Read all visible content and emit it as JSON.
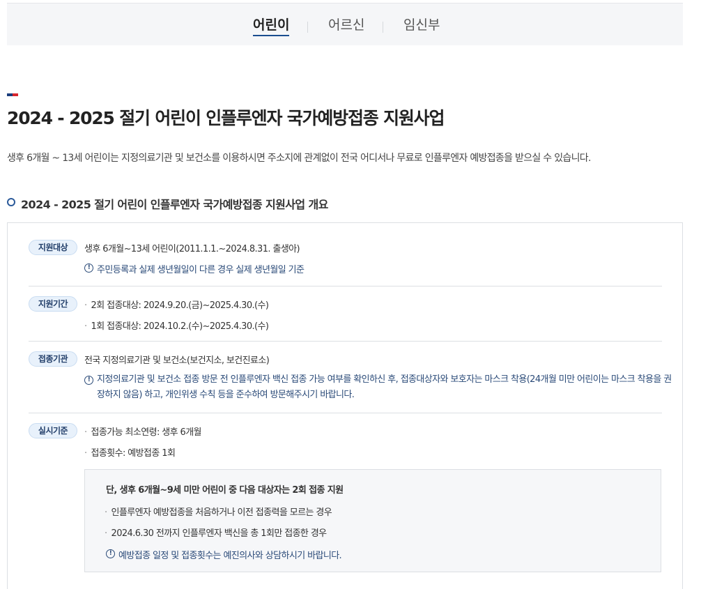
{
  "tabs": [
    {
      "label": "어린이",
      "active": true
    },
    {
      "label": "어르신",
      "active": false
    },
    {
      "label": "임신부",
      "active": false
    }
  ],
  "accent_colors": {
    "navy": "#1a3d7c",
    "red": "#d8262e",
    "link": "#2a4a78"
  },
  "page_title": "2024 - 2025 절기 어린이 인플루엔자 국가예방접종 지원사업",
  "intro": "생후 6개월 ~ 13세 어린이는 지정의료기관 및 보건소를 이용하시면 주소지에 관계없이 전국 어디서나 무료로 인플루엔자 예방접종을 받으실 수 있습니다.",
  "section_title": "2024 - 2025 절기 어린이 인플루엔자 국가예방접종 지원사업 개요",
  "rows": {
    "target": {
      "badge": "지원대상",
      "text": "생후 6개월~13세 어린이(2011.1.1.~2024.8.31. 출생아)",
      "note": "주민등록과 실제 생년월일이 다른 경우 실제 생년월일 기준"
    },
    "period": {
      "badge": "지원기간",
      "items": [
        "2회 접종대상: 2024.9.20.(금)~2025.4.30.(수)",
        "1회 접종대상: 2024.10.2.(수)~2025.4.30.(수)"
      ]
    },
    "institution": {
      "badge": "접종기관",
      "text": "전국 지정의료기관 및 보건소(보건지소, 보건진료소)",
      "note": "지정의료기관 및 보건소 접종 방문 전 인플루엔자 백신 접종 가능 여부를 확인하신 후, 접종대상자와 보호자는 마스크 착용(24개월 미만 어린이는 마스크 착용을 권장하지 않음) 하고, 개인위생 수칙 등을 준수하여 방문해주시기 바랍니다."
    },
    "criteria": {
      "badge": "실시기준",
      "items": [
        "접종가능 최소연령: 생후 6개월",
        "접종횟수: 예방접종 1회"
      ],
      "subbox": {
        "title": "단, 생후 6개월~9세 미만 어린이 중 다음 대상자는 2회 접종 지원",
        "items": [
          "인플루엔자 예방접종을 처음하거나 이전 접종력을 모르는 경우",
          "2024.6.30 전까지 인플루엔자 백신을 총 1회만 접종한 경우"
        ],
        "note": "예방접종 일정 및 접종횟수는 예진의사와 상담하시기 바랍니다."
      }
    }
  },
  "bullet": "·",
  "info_icon": "!",
  "icons": {
    "info": "info-circle-icon",
    "section": "ring-bullet-icon"
  }
}
